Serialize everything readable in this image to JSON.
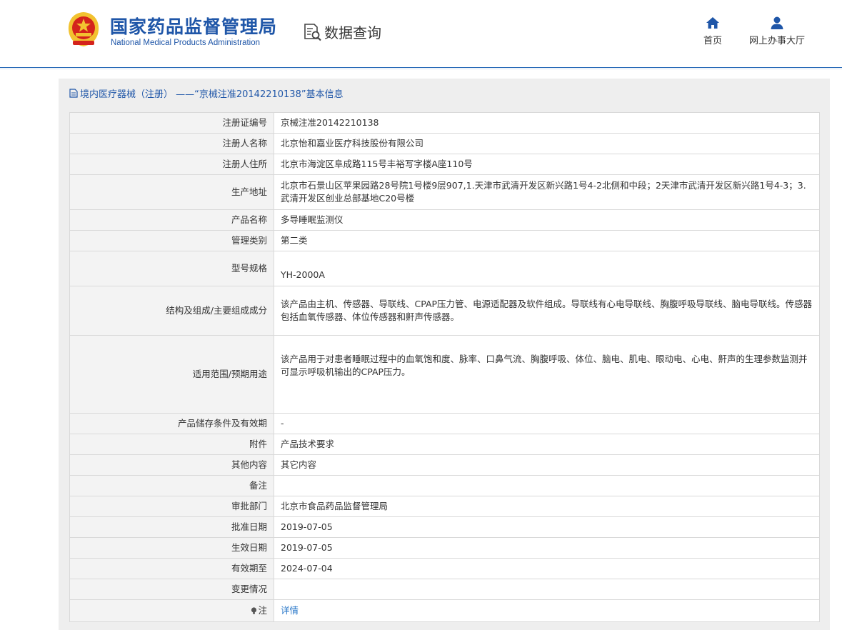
{
  "header": {
    "org_name_cn": "国家药品监督管理局",
    "org_name_en": "National Medical Products Administration",
    "data_query_label": "数据查询",
    "nav": {
      "home_label": "首页",
      "online_hall_label": "网上办事大厅"
    }
  },
  "panel": {
    "title": "境内医疗器械（注册） ——“京械注准20142210138”基本信息"
  },
  "rows": [
    {
      "label": "注册证编号",
      "value": "京械注准20142210138"
    },
    {
      "label": "注册人名称",
      "value": "北京怡和嘉业医疗科技股份有限公司"
    },
    {
      "label": "注册人住所",
      "value": "北京市海淀区阜成路115号丰裕写字楼A座110号"
    },
    {
      "label": "生产地址",
      "value": "北京市石景山区苹果园路28号院1号楼9层907,1.天津市武清开发区新兴路1号4-2北侧和中段；2天津市武清开发区新兴路1号4-3；3.武清开发区创业总部基地C20号楼"
    },
    {
      "label": "产品名称",
      "value": "多导睡眠监测仪"
    },
    {
      "label": "管理类别",
      "value": "第二类"
    },
    {
      "label": "型号规格",
      "value": "YH-2000A"
    },
    {
      "label": "结构及组成/主要组成成分",
      "value": "该产品由主机、传感器、导联线、CPAP压力管、电源适配器及软件组成。导联线有心电导联线、胸腹呼吸导联线、脑电导联线。传感器包括血氧传感器、体位传感器和鼾声传感器。"
    },
    {
      "label": "适用范围/预期用途",
      "value": "该产品用于对患者睡眠过程中的血氧饱和度、脉率、口鼻气流、胸腹呼吸、体位、脑电、肌电、眼动电、心电、鼾声的生理参数监测并可显示呼吸机输出的CPAP压力。"
    },
    {
      "label": "产品储存条件及有效期",
      "value": "-"
    },
    {
      "label": "附件",
      "value": "产品技术要求"
    },
    {
      "label": "其他内容",
      "value": "其它内容"
    },
    {
      "label": "备注",
      "value": ""
    },
    {
      "label": "审批部门",
      "value": "北京市食品药品监督管理局"
    },
    {
      "label": "批准日期",
      "value": "2019-07-05"
    },
    {
      "label": "生效日期",
      "value": "2019-07-05"
    },
    {
      "label": "有效期至",
      "value": "2024-07-04"
    },
    {
      "label": "变更情况",
      "value": ""
    },
    {
      "label": "注",
      "value": "详情"
    }
  ],
  "colors": {
    "brand_blue": "#1f56a8",
    "link_blue": "#2a78c9",
    "emblem_red": "#d4231c",
    "emblem_gold": "#f2c230"
  }
}
